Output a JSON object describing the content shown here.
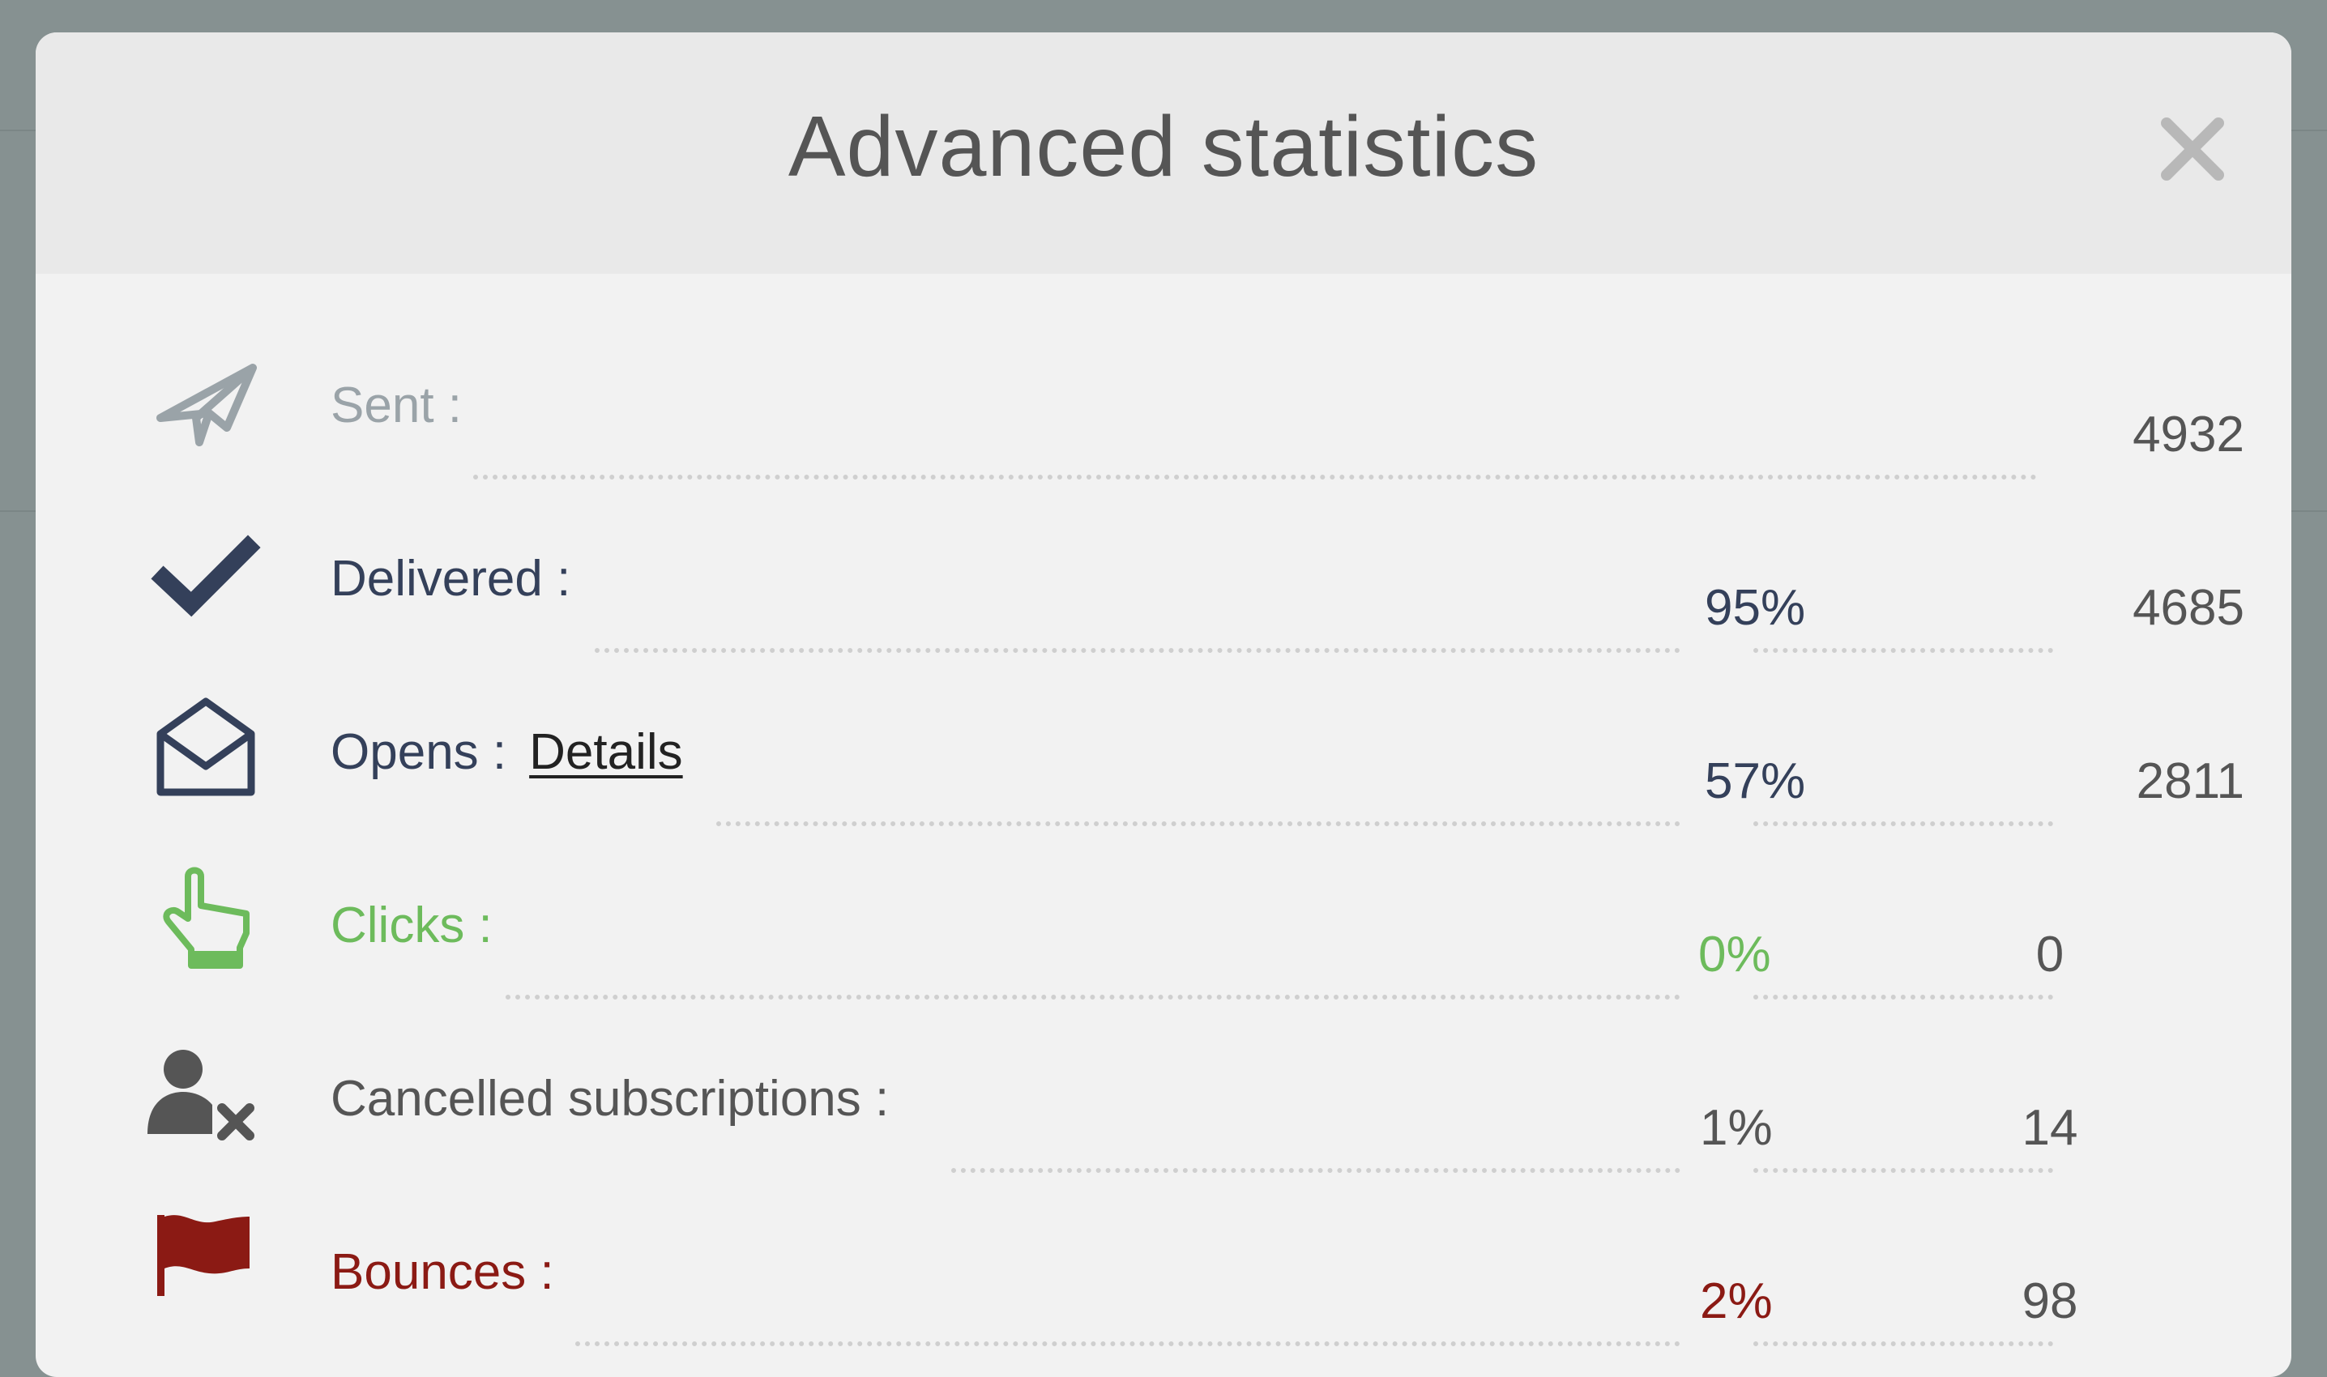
{
  "modal": {
    "title": "Advanced statistics",
    "close_icon": "close-icon"
  },
  "rows": [
    {
      "icon": "paper-plane-icon",
      "label": "Sent :",
      "percent": "",
      "count": "4932",
      "color": "#9aa3a8"
    },
    {
      "icon": "checkmark-icon",
      "label": "Delivered :",
      "percent": "95%",
      "count": "4685",
      "color": "#34405a"
    },
    {
      "icon": "open-envelope-icon",
      "label": "Opens :",
      "link": "Details",
      "percent": "57%",
      "count": "2811",
      "color": "#34405a"
    },
    {
      "icon": "pointing-hand-icon",
      "label": "Clicks :",
      "percent": "0%",
      "count": "0",
      "color": "#6dbb5c"
    },
    {
      "icon": "user-remove-icon",
      "label": "Cancelled subscriptions :",
      "percent": "1%",
      "count": "14",
      "color": "#555555"
    },
    {
      "icon": "flag-icon",
      "label": "Bounces :",
      "percent": "2%",
      "count": "98",
      "color": "#8b1a14"
    }
  ]
}
